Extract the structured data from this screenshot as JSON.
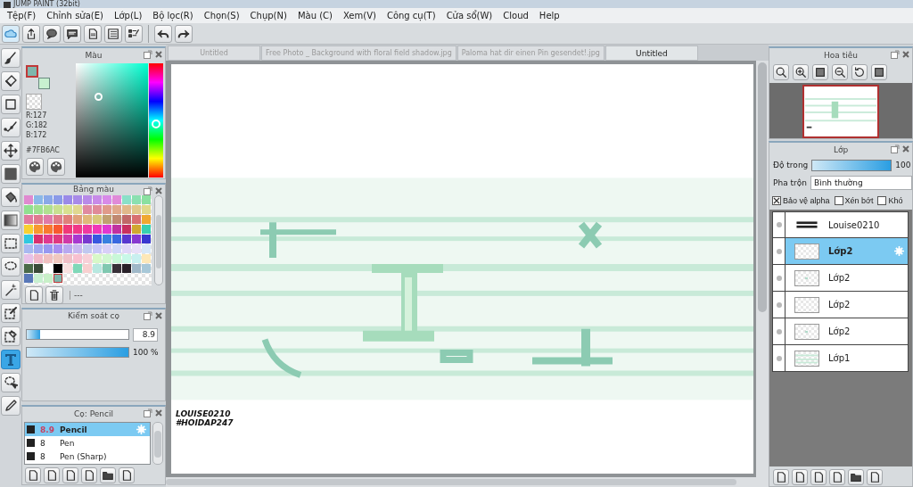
{
  "window": {
    "title": "JUMP PAINT (32bit)"
  },
  "menu": [
    "Tệp(F)",
    "Chỉnh sửa(E)",
    "Lớp(L)",
    "Bộ lọc(R)",
    "Chọn(S)",
    "Chụp(N)",
    "Màu (C)",
    "Xem(V)",
    "Công cụ(T)",
    "Cửa sổ(W)",
    "Cloud",
    "Help"
  ],
  "tools": [
    {
      "kind": "brush",
      "selected": false
    },
    {
      "kind": "eraser",
      "selected": false
    },
    {
      "kind": "rect",
      "selected": false
    },
    {
      "kind": "line",
      "selected": false
    },
    {
      "kind": "move",
      "selected": false
    },
    {
      "kind": "fill-rect",
      "selected": false
    },
    {
      "kind": "bucket",
      "selected": false
    },
    {
      "kind": "gradient",
      "selected": false
    },
    {
      "kind": "select-rect",
      "selected": false
    },
    {
      "kind": "lasso",
      "selected": false
    },
    {
      "kind": "wand",
      "selected": false
    },
    {
      "kind": "select-pen",
      "selected": false
    },
    {
      "kind": "select-eraser",
      "selected": false
    },
    {
      "kind": "text",
      "selected": true
    },
    {
      "kind": "select-move",
      "selected": false
    },
    {
      "kind": "dropper",
      "selected": false
    }
  ],
  "color_panel": {
    "title": "Màu",
    "current_colors": [
      {
        "kind": "foreground",
        "color": "#7fb6ac"
      },
      {
        "kind": "background",
        "color": "#c8f0d0"
      }
    ],
    "r": "R:127",
    "g": "G:182",
    "b": "B:172",
    "hex": "#7FB6AC"
  },
  "palette_panel": {
    "title": "Bảng màu",
    "status": "---",
    "swatches": [
      {
        "color": "#e08ad0"
      },
      {
        "color": "#8ab8e8"
      },
      {
        "color": "#8aa8e8"
      },
      {
        "color": "#8a9ae8"
      },
      {
        "color": "#9a8ae8"
      },
      {
        "color": "#a88ae8"
      },
      {
        "color": "#b88ae8"
      },
      {
        "color": "#c88ae8"
      },
      {
        "color": "#d88ae8"
      },
      {
        "color": "#e08ad8"
      },
      {
        "color": "#8ae0c8"
      },
      {
        "color": "#8ae0b0"
      },
      {
        "color": "#8ae0a0"
      },
      {
        "color": "#90e090"
      },
      {
        "color": "#a0e090"
      },
      {
        "color": "#b0e090"
      },
      {
        "color": "#c8e090"
      },
      {
        "color": "#d8e090"
      },
      {
        "color": "#e0d890"
      },
      {
        "color": "#e08aa0"
      },
      {
        "color": "#e08a98"
      },
      {
        "color": "#e09a8a"
      },
      {
        "color": "#e0a88a"
      },
      {
        "color": "#e0b88a"
      },
      {
        "color": "#e0c88a"
      },
      {
        "color": "#e0d88a"
      },
      {
        "color": "#e07aa0"
      },
      {
        "color": "#e07a90"
      },
      {
        "color": "#e07aa8"
      },
      {
        "color": "#e07a88"
      },
      {
        "color": "#e0807a"
      },
      {
        "color": "#e0a07a"
      },
      {
        "color": "#e0b87a"
      },
      {
        "color": "#d8c87a"
      },
      {
        "color": "#c0a070"
      },
      {
        "color": "#c08870"
      },
      {
        "color": "#c06868"
      },
      {
        "color": "#d87070"
      },
      {
        "color": "#f0a830"
      },
      {
        "color": "#f8d030"
      },
      {
        "color": "#f89830"
      },
      {
        "color": "#f87830"
      },
      {
        "color": "#f85830"
      },
      {
        "color": "#f03878"
      },
      {
        "color": "#f03888"
      },
      {
        "color": "#f038a0"
      },
      {
        "color": "#f038b8"
      },
      {
        "color": "#e038d0"
      },
      {
        "color": "#c030a0"
      },
      {
        "color": "#c83060"
      },
      {
        "color": "#d0a830"
      },
      {
        "color": "#38d0b0"
      },
      {
        "color": "#30c8e0"
      },
      {
        "color": "#d83070"
      },
      {
        "color": "#e03890"
      },
      {
        "color": "#e03880"
      },
      {
        "color": "#d038a8"
      },
      {
        "color": "#a838d0"
      },
      {
        "color": "#7838d0"
      },
      {
        "color": "#3858e0"
      },
      {
        "color": "#3880e0"
      },
      {
        "color": "#3868e0"
      },
      {
        "color": "#5838d0"
      },
      {
        "color": "#8838d0"
      },
      {
        "color": "#3838d0"
      },
      {
        "color": "#a8b8f0"
      },
      {
        "color": "#a0a8f0"
      },
      {
        "color": "#9898f0"
      },
      {
        "color": "#a890f0"
      },
      {
        "color": "#b8a8f0"
      },
      {
        "color": "#c8b8f0"
      },
      {
        "color": "#c0c8f0"
      },
      {
        "color": "#c8c8f8"
      },
      {
        "color": "#d8d0f8"
      },
      {
        "color": "#d0d8f8"
      },
      {
        "color": "#e0d8f8"
      },
      {
        "color": "#e8e0f8"
      },
      {
        "color": "#d8e8f8"
      },
      {
        "color": "#e8c0e8"
      },
      {
        "color": "#f0b8c8"
      },
      {
        "color": "#f0c0c0"
      },
      {
        "color": "#f0c8c0"
      },
      {
        "color": "#f0c0c8"
      },
      {
        "color": "#f8c0d0"
      },
      {
        "color": "#f8d0d8"
      },
      {
        "color": "#d8f8c8"
      },
      {
        "color": "#d0f8d0"
      },
      {
        "color": "#c8f8d8"
      },
      {
        "color": "#c8f8e8"
      },
      {
        "color": "#c8f0f0"
      },
      {
        "color": "#fde8b8"
      },
      {
        "color": "#4a6a48"
      },
      {
        "color": "#3a4a38"
      },
      {
        "color": "#ffffff"
      },
      {
        "color": "#000000"
      },
      {
        "color": "#f8e0e0"
      },
      {
        "color": "#80d8b8"
      },
      {
        "color": "#f8d0d0"
      },
      {
        "color": "#b8e8e0"
      },
      {
        "color": "#80c8b0"
      },
      {
        "color": "#383038"
      },
      {
        "color": "#282028"
      },
      {
        "color": "#a0b8c8"
      },
      {
        "color": "#a8c8d8"
      },
      {
        "color": "#5878b8"
      },
      {
        "color": "#c8f0d0"
      },
      {
        "color": "#c8f0c8"
      },
      {
        "color": "#7fb6ac"
      }
    ]
  },
  "brush_control": {
    "title": "Kiểm soát cọ",
    "size": {
      "level": 0.13,
      "reading": "8.9"
    },
    "opacity": {
      "level": 1,
      "reading": "100 %"
    }
  },
  "brush_panel": {
    "title": "Cọ: Pencil",
    "brushes": [
      {
        "size": "8.9",
        "name": "Pencil",
        "selected": true
      },
      {
        "size": "8",
        "name": "Pen",
        "selected": false
      },
      {
        "size": "8",
        "name": "Pen (Sharp)",
        "selected": false
      }
    ]
  },
  "tabs": [
    {
      "label": "Untitled",
      "selected": false
    },
    {
      "label": "Free Photo _ Background with floral field shadow.jpg",
      "selected": false
    },
    {
      "label": "Paloma hat dir einen Pin gesendet!.jpg",
      "selected": false
    },
    {
      "label": "Untitled",
      "selected": true
    }
  ],
  "canvas": {
    "signature": [
      "LOUISE0210",
      "#HOIDAP247"
    ]
  },
  "navigator": {
    "title": "Hoa tiêu"
  },
  "layers_panel": {
    "title": "Lớp",
    "opacity_label": "Độ trong",
    "opacity": {
      "level": 1,
      "reading": "100"
    },
    "blend_label": "Pha trộn",
    "blend": "Bình thường",
    "options": [
      {
        "label": "Bảo vệ alpha",
        "checked": true
      },
      {
        "label": "Xén bớt",
        "checked": false
      },
      {
        "label": "Khó",
        "checked": false
      }
    ],
    "layers": [
      {
        "name": "Louise0210",
        "kind": "text",
        "selected": false
      },
      {
        "name": "Lớp2",
        "kind": "empty",
        "selected": true
      },
      {
        "name": "Lớp2",
        "kind": "mark",
        "selected": false
      },
      {
        "name": "Lớp2",
        "kind": "empty",
        "selected": false
      },
      {
        "name": "Lớp2",
        "kind": "mark",
        "selected": false
      },
      {
        "name": "Lớp1",
        "kind": "lines",
        "selected": false
      }
    ]
  }
}
